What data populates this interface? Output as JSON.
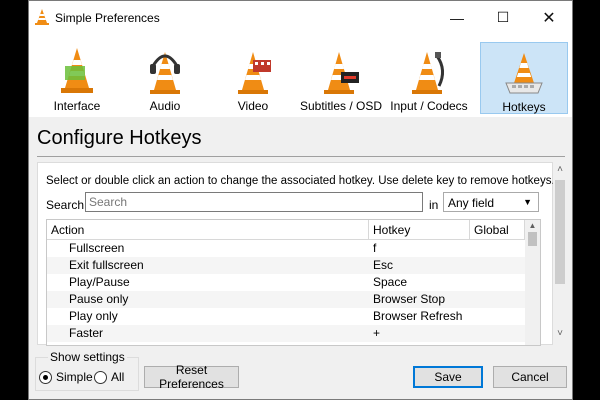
{
  "window": {
    "title": "Simple Preferences",
    "controls": {
      "minimize": "—",
      "maximize": "☐",
      "close": "✕"
    }
  },
  "toolbar": {
    "items": [
      {
        "label": "Interface",
        "icon": "interface-cone-icon",
        "selected": false
      },
      {
        "label": "Audio",
        "icon": "audio-cone-headphones-icon",
        "selected": false
      },
      {
        "label": "Video",
        "icon": "video-cone-film-icon",
        "selected": false
      },
      {
        "label": "Subtitles / OSD",
        "icon": "subtitles-cone-display-icon",
        "selected": false
      },
      {
        "label": "Input / Codecs",
        "icon": "input-cone-cable-icon",
        "selected": false
      },
      {
        "label": "Hotkeys",
        "icon": "hotkeys-cone-keyboard-icon",
        "selected": true
      }
    ]
  },
  "page": {
    "heading": "Configure Hotkeys",
    "instructions": "Select or double click an action to change the associated hotkey. Use delete key to remove hotkeys."
  },
  "search": {
    "label": "Search",
    "placeholder": "Search",
    "value": "",
    "in_label": "in",
    "field_selected": "Any field"
  },
  "table": {
    "columns": [
      "Action",
      "Hotkey",
      "Global"
    ],
    "rows": [
      {
        "action": "Fullscreen",
        "hotkey": "f",
        "global": ""
      },
      {
        "action": "Exit fullscreen",
        "hotkey": "Esc",
        "global": ""
      },
      {
        "action": "Play/Pause",
        "hotkey": "Space",
        "global": ""
      },
      {
        "action": "Pause only",
        "hotkey": "Browser Stop",
        "global": ""
      },
      {
        "action": "Play only",
        "hotkey": "Browser Refresh",
        "global": ""
      },
      {
        "action": "Faster",
        "hotkey": "+",
        "global": ""
      }
    ]
  },
  "show_settings": {
    "legend": "Show settings",
    "options": [
      "Simple",
      "All"
    ],
    "selected": "Simple"
  },
  "buttons": {
    "reset": "Reset Preferences",
    "save": "Save",
    "cancel": "Cancel"
  },
  "colors": {
    "selected_tab_bg": "#cce4f7",
    "cone_orange": "#f08c14",
    "default_button_border": "#0078d7"
  }
}
